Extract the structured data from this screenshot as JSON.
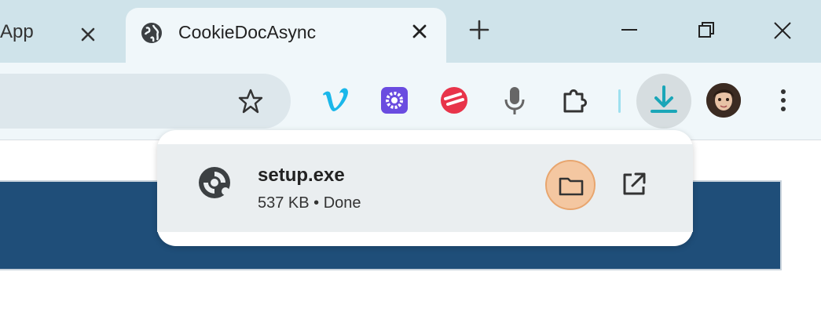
{
  "tabs": {
    "inactive_title": "App",
    "active_title": "CookieDocAsync"
  },
  "toolbar": {
    "extensions": [
      "vimeo-icon",
      "flower-extension-icon",
      "red-stripes-extension-icon",
      "microphone-icon",
      "puzzle-extensions-icon"
    ],
    "colors": {
      "vimeo": "#1ab7ea",
      "flower": "#6a4ce0",
      "red": "#e8344a",
      "accent": "#1aa6b8"
    }
  },
  "download": {
    "filename": "setup.exe",
    "status": "537 KB • Done"
  }
}
